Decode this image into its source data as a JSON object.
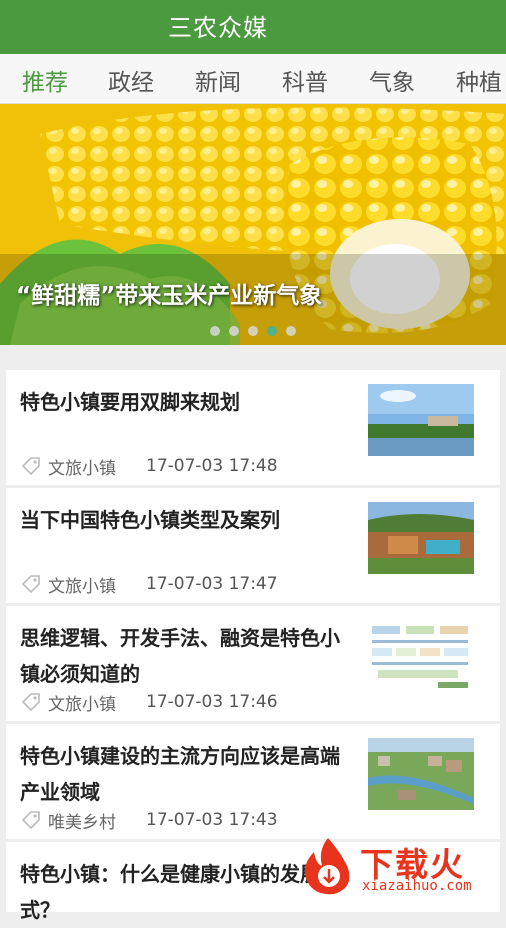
{
  "app": {
    "title": "三农众媒"
  },
  "tabs": [
    {
      "label": "推荐",
      "active": true
    },
    {
      "label": "政经",
      "active": false
    },
    {
      "label": "新闻",
      "active": false
    },
    {
      "label": "科普",
      "active": false
    },
    {
      "label": "气象",
      "active": false
    },
    {
      "label": "种植",
      "active": false
    }
  ],
  "banner": {
    "caption": "“鲜甜糯”带来玉米产业新气象",
    "slide_count": 5,
    "active_slide": 3
  },
  "articles": [
    {
      "title": "特色小镇要用双脚来规划",
      "tag": "文旅小镇",
      "time": "17-07-03 17:48",
      "thumb": "lake-town-photo"
    },
    {
      "title": "当下中国特色小镇类型及案列",
      "tag": "文旅小镇",
      "time": "17-07-03 17:47",
      "thumb": "resort-aerial-photo"
    },
    {
      "title": "思维逻辑、开发手法、融资是特色小镇必须知道的",
      "tag": "文旅小镇",
      "time": "17-07-03 17:46",
      "thumb": "diagram-chart"
    },
    {
      "title": "特色小镇建设的主流方向应该是高端产业领域",
      "tag": "唯美乡村",
      "time": "17-07-03 17:43",
      "thumb": "green-town-rendering"
    },
    {
      "title": "特色小镇：什么是健康小镇的发展模式？",
      "tag": "",
      "time": "",
      "thumb": ""
    }
  ],
  "watermark": {
    "text": "下载火",
    "url": "xiazaihuo.com"
  },
  "colors": {
    "appbar": "#4c9a3f",
    "accent": "#4c9a3f",
    "dot_active": "#39b5a5",
    "watermark": "#e8341c"
  }
}
